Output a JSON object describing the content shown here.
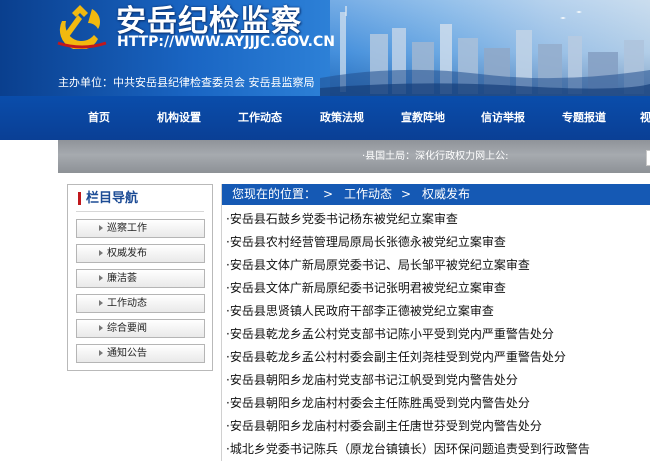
{
  "header": {
    "site_title": "安岳纪检监察",
    "site_url": "HTTP://WWW.AYJJJC.GOV.CN",
    "sponsor": "主办单位：中共安岳县纪律检查委员会 安岳县监察局"
  },
  "nav": {
    "items": [
      {
        "label": "首页"
      },
      {
        "label": "机构设置"
      },
      {
        "label": "工作动态"
      },
      {
        "label": "政策法规"
      },
      {
        "label": "宣教阵地"
      },
      {
        "label": "信访举报"
      },
      {
        "label": "专题报道"
      },
      {
        "label": "视"
      }
    ]
  },
  "ticker": {
    "text": "·县国土局：深化行政权力网上公:"
  },
  "sidebar": {
    "title": "栏目导航",
    "items": [
      {
        "label": "巡察工作"
      },
      {
        "label": "权威发布"
      },
      {
        "label": "廉洁荟"
      },
      {
        "label": "工作动态"
      },
      {
        "label": "综合要闻"
      },
      {
        "label": "通知公告"
      }
    ]
  },
  "breadcrumb": {
    "prefix": "您现在的位置：",
    "sep1": ">",
    "level1": "工作动态",
    "sep2": ">",
    "level2": "权威发布"
  },
  "news": [
    {
      "title": "·安岳县石鼓乡党委书记杨东被党纪立案审查"
    },
    {
      "title": "·安岳县农村经营管理局原局长张德永被党纪立案审查"
    },
    {
      "title": "·安岳县文体广新局原党委书记、局长邹平被党纪立案审查"
    },
    {
      "title": "·安岳县文体广新局原纪委书记张明君被党纪立案审查"
    },
    {
      "title": "·安岳县思贤镇人民政府干部李正德被党纪立案审查"
    },
    {
      "title": "·安岳县乾龙乡孟公村党支部书记陈小平受到党内严重警告处分"
    },
    {
      "title": "·安岳县乾龙乡孟公村村委会副主任刘尧桂受到党内严重警告处分"
    },
    {
      "title": "·安岳县朝阳乡龙庙村党支部书记江帆受到党内警告处分"
    },
    {
      "title": "·安岳县朝阳乡龙庙村村委会主任陈胜禹受到党内警告处分"
    },
    {
      "title": "·安岳县朝阳乡龙庙村村委会副主任唐世芬受到党内警告处分"
    },
    {
      "title": "·城北乡党委书记陈兵（原龙台镇镇长）因环保问题追责受到行政警告"
    }
  ],
  "colors": {
    "nav_blue": "#0a4dab",
    "crumb_blue": "#1559b4",
    "accent_red": "#c0181d",
    "emblem_gold": "#f2b90f"
  }
}
